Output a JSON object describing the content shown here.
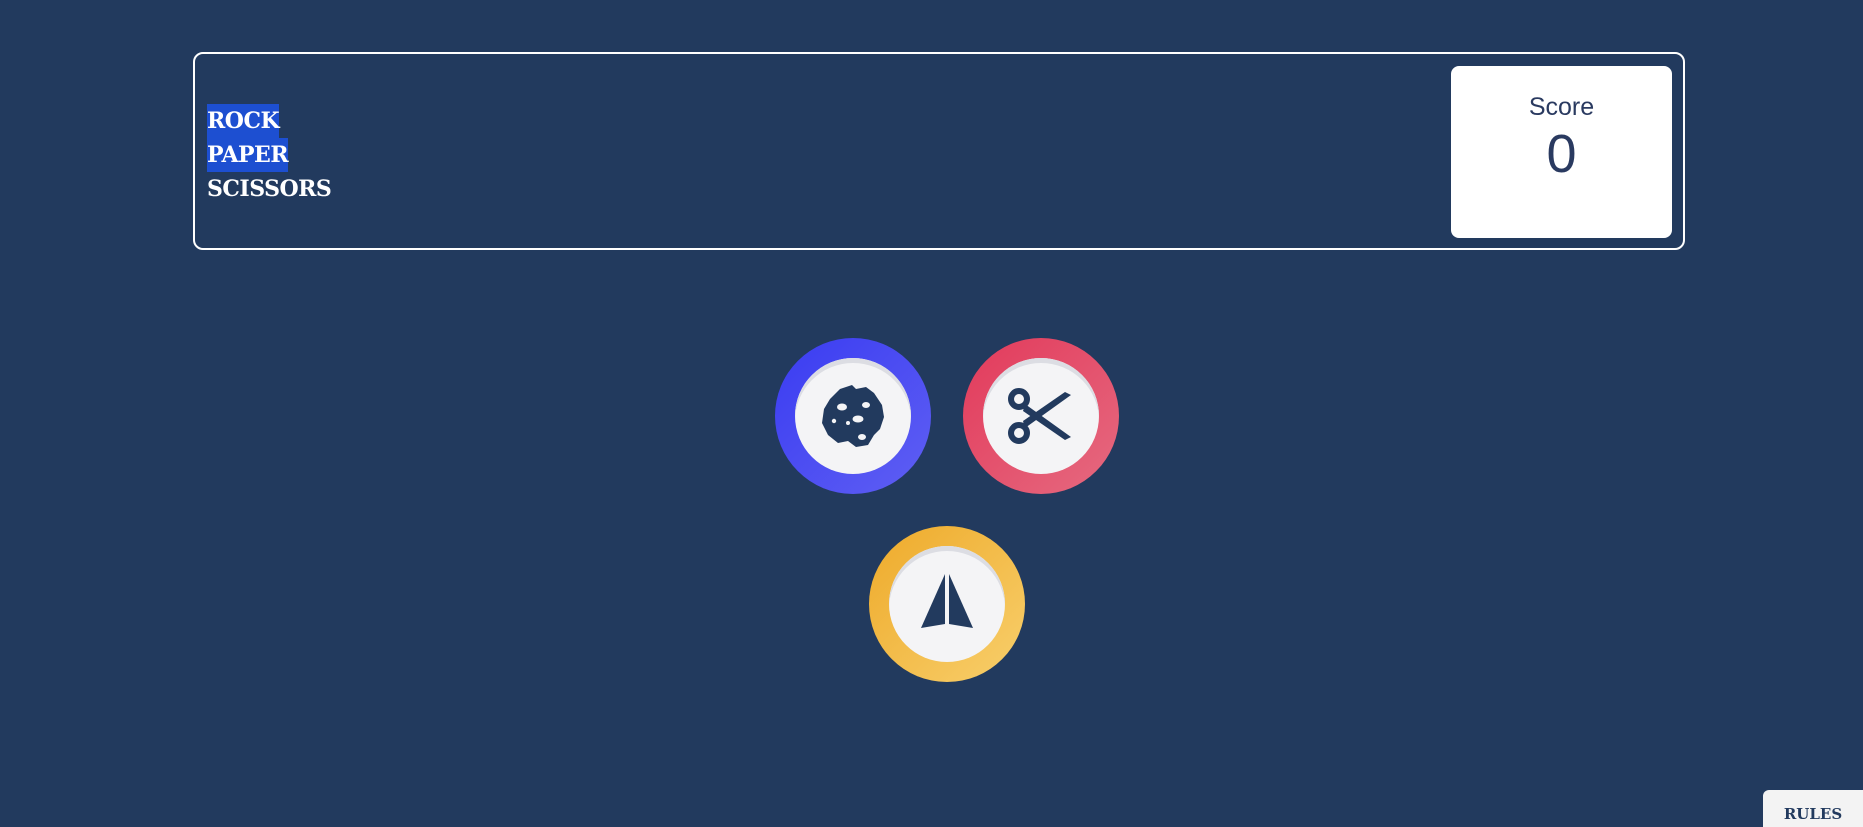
{
  "title": {
    "lines": [
      "ROCK",
      "PAPER",
      "SCISSORS"
    ]
  },
  "score": {
    "label": "Score",
    "value": "0"
  },
  "choices": [
    {
      "name": "rock",
      "icon": "rock-icon",
      "color_from": "#3a3cf2",
      "color_to": "#5f5ff3"
    },
    {
      "name": "scissors",
      "icon": "scissors-icon",
      "color_from": "#e23a5b",
      "color_to": "#e66a80"
    },
    {
      "name": "paper",
      "icon": "paper-plane-icon",
      "color_from": "#eeaa2a",
      "color_to": "#f8cf6c"
    }
  ],
  "rules": {
    "label": "RULES"
  },
  "colors": {
    "background": "#223a5e",
    "text_dark": "#2a3a60",
    "selection": "#1d4fd1"
  }
}
